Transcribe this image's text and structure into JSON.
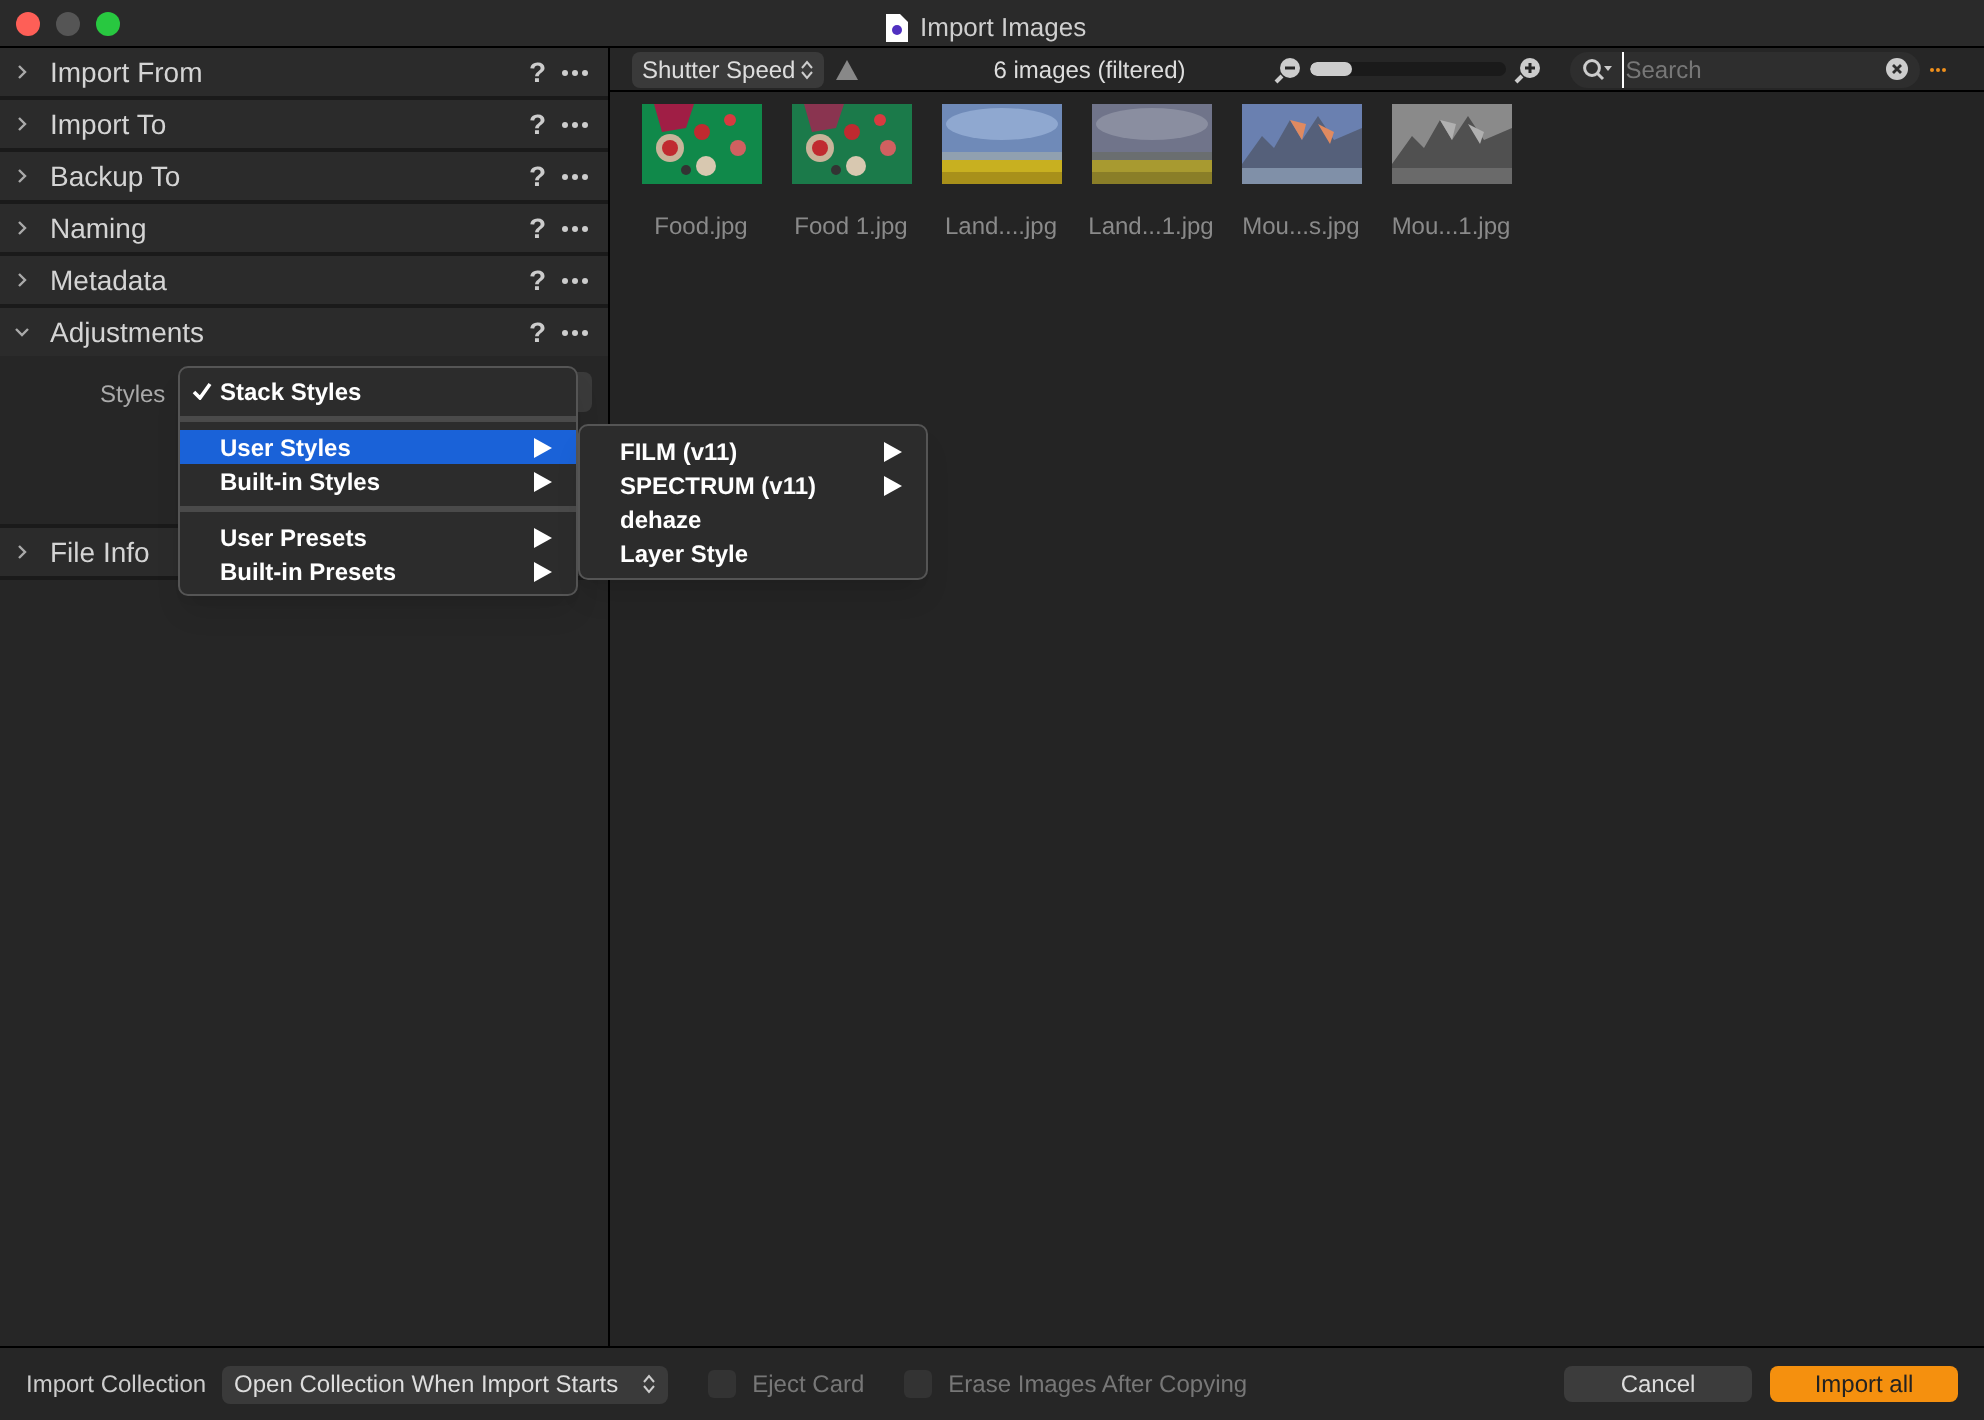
{
  "window": {
    "title": "Import Images"
  },
  "sections": [
    {
      "label": "Import From",
      "expanded": false,
      "help": "?"
    },
    {
      "label": "Import To",
      "expanded": false,
      "help": "?"
    },
    {
      "label": "Backup To",
      "expanded": false,
      "help": "?"
    },
    {
      "label": "Naming",
      "expanded": false,
      "help": "?"
    },
    {
      "label": "Metadata",
      "expanded": false,
      "help": "?"
    },
    {
      "label": "Adjustments",
      "expanded": true,
      "help": "?",
      "field_label": "Styles"
    },
    {
      "label": "File Info",
      "expanded": false
    }
  ],
  "styles_menu": [
    {
      "kind": "check",
      "label": "Stack Styles",
      "checked": true
    },
    {
      "kind": "separator"
    },
    {
      "kind": "item",
      "label": "User Styles",
      "selected": true,
      "submenu": true
    },
    {
      "kind": "item",
      "label": "Built-in Styles",
      "selected": false,
      "submenu": true
    },
    {
      "kind": "separator"
    },
    {
      "kind": "item",
      "label": "User Presets",
      "selected": false,
      "submenu": true
    },
    {
      "kind": "item",
      "label": "Built-in Presets",
      "selected": false,
      "submenu": true
    }
  ],
  "submenu": [
    {
      "label": "FILM (v11)",
      "submenu": true
    },
    {
      "label": "SPECTRUM (v11)",
      "submenu": true
    },
    {
      "label": "dehaze",
      "submenu": false
    },
    {
      "label": "Layer Style",
      "submenu": false
    }
  ],
  "toolbar": {
    "sort": "Shutter Speed",
    "count": "6 images (filtered)",
    "zoom": {
      "level": 0.22
    },
    "search_placeholder": "Search"
  },
  "images": [
    {
      "name": "Food.jpg",
      "kind": "picture"
    },
    {
      "name": "Food 1.jpg",
      "kind": "picture"
    },
    {
      "name": "Land....jpg",
      "kind": "picture"
    },
    {
      "name": "Land...1.jpg",
      "kind": "picture"
    },
    {
      "name": "Mou...s.jpg",
      "kind": "picture"
    },
    {
      "name": "Mou...1.jpg",
      "kind": "picture"
    }
  ],
  "footer": {
    "collection_label": "Import Collection",
    "collection_value": "Open Collection When Import Starts",
    "checkboxes": [
      {
        "label": "Eject Card",
        "checked": false
      },
      {
        "label": "Erase Images After Copying",
        "checked": false
      }
    ],
    "buttons": [
      {
        "label": "Cancel",
        "kind": "secondary"
      },
      {
        "label": "Import all",
        "kind": "primary"
      }
    ]
  }
}
